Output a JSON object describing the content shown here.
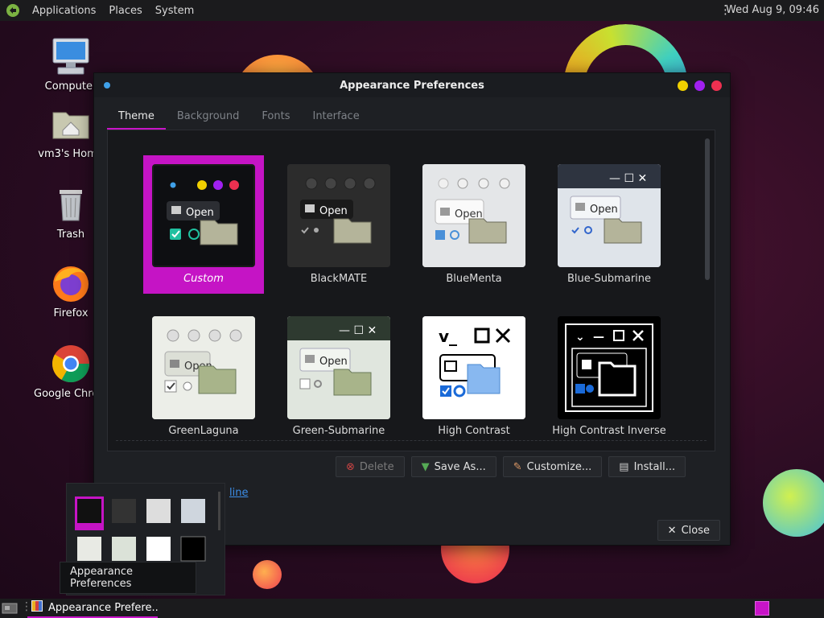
{
  "top_panel": {
    "menus": [
      "Applications",
      "Places",
      "System"
    ],
    "clock": "Wed Aug  9, 09:46"
  },
  "desktop_icons": [
    {
      "label": "Computer",
      "icon": "computer-icon"
    },
    {
      "label": "vm3's Home",
      "icon": "home-folder-icon"
    },
    {
      "label": "Trash",
      "icon": "trash-icon"
    },
    {
      "label": "Firefox",
      "icon": "firefox-icon"
    },
    {
      "label": "Google Chrome",
      "icon": "chrome-icon"
    }
  ],
  "window": {
    "title": "Appearance Preferences",
    "tabs": [
      "Theme",
      "Background",
      "Fonts",
      "Interface"
    ],
    "active_tab": "Theme",
    "themes": [
      {
        "name": "Custom",
        "selected": true
      },
      {
        "name": "BlackMATE"
      },
      {
        "name": "BlueMenta"
      },
      {
        "name": "Blue-Submarine"
      },
      {
        "name": "GreenLaguna"
      },
      {
        "name": "Green-Submarine"
      },
      {
        "name": "High Contrast"
      },
      {
        "name": "High Contrast Inverse"
      }
    ],
    "thumb_open_label": "Open",
    "buttons": {
      "delete": "Delete",
      "save_as": "Save As...",
      "customize": "Customize...",
      "install": "Install..."
    },
    "link_text": "line",
    "close": "Close"
  },
  "taskbar": {
    "task_label": "Appearance Prefere...",
    "tooltip": "Appearance Preferences"
  },
  "colors": {
    "accent": "#c814c8",
    "link": "#3c8ee8"
  }
}
